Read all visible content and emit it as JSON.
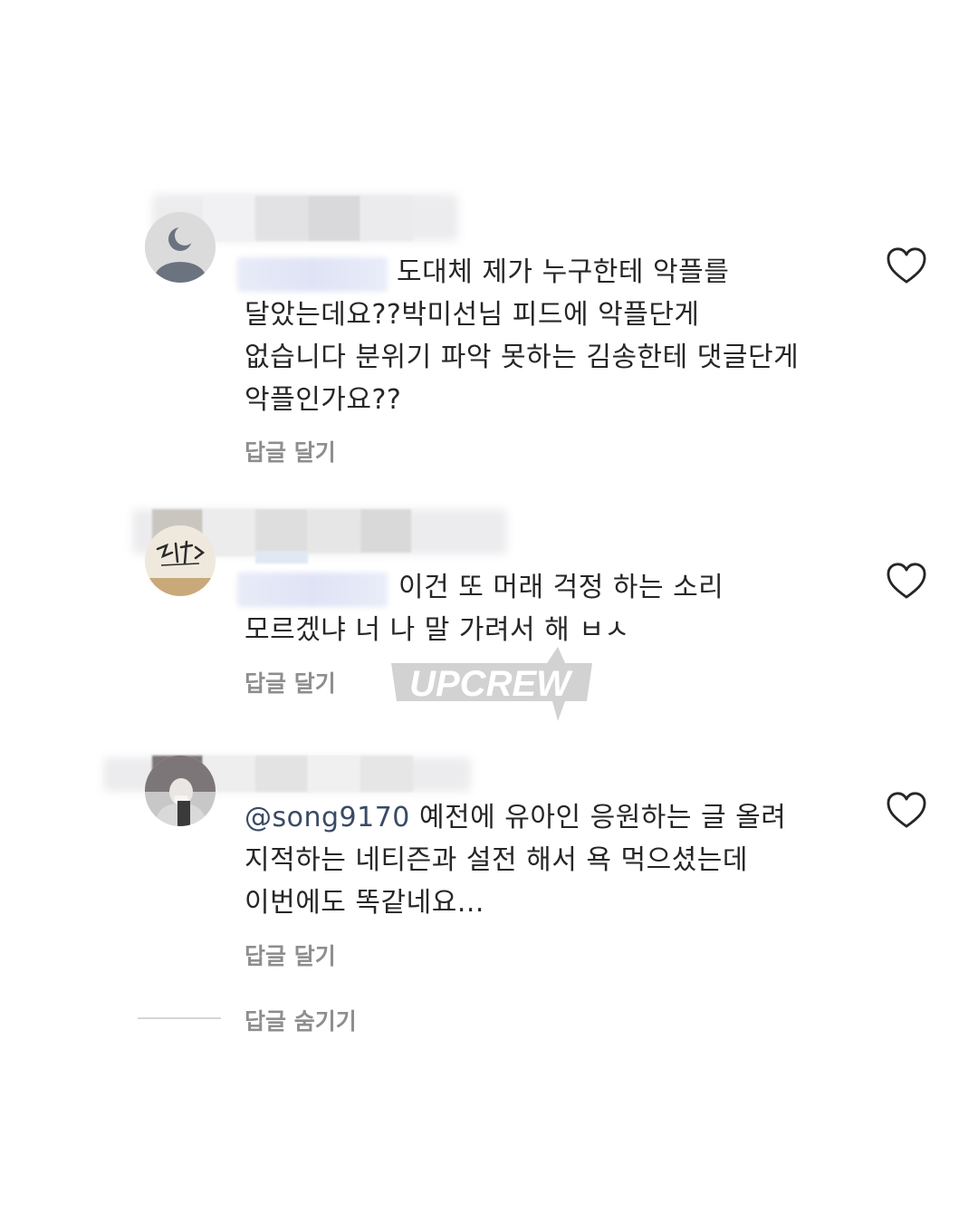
{
  "comments": [
    {
      "text_lines": [
        "도대체 제가 누구한테 악플를",
        "달았는데요??박미선님 피드에 악플단게",
        "없습니다 분위기 파악 못하는 김송한테 댓글단게",
        "악플인가요??"
      ],
      "reply_label": "답글 달기",
      "avatar": "default-user-icon"
    },
    {
      "text_lines": [
        "이건 또 머래 걱정 하는 소리",
        "모르겠냐 너 나 말 가려서 해 ㅂㅅ"
      ],
      "reply_label": "답글 달기",
      "avatar": "logo-avatar"
    },
    {
      "mention": "@song9170",
      "text_lines": [
        "예전에  유아인 응원하는 글  올려",
        "지적하는 네티즌과 설전 해서 욕 먹으셨는데",
        "이번에도 똑같네요..."
      ],
      "reply_label": "답글 달기",
      "avatar": "photo-avatar"
    }
  ],
  "hide_replies_label": "답글 숨기기",
  "watermark_text": "UPCREW",
  "icons": {
    "like": "heart-outline-icon"
  },
  "colors": {
    "text": "#262626",
    "secondary": "#8e8e8e",
    "mention": "#3a4a66",
    "background": "#ffffff"
  }
}
